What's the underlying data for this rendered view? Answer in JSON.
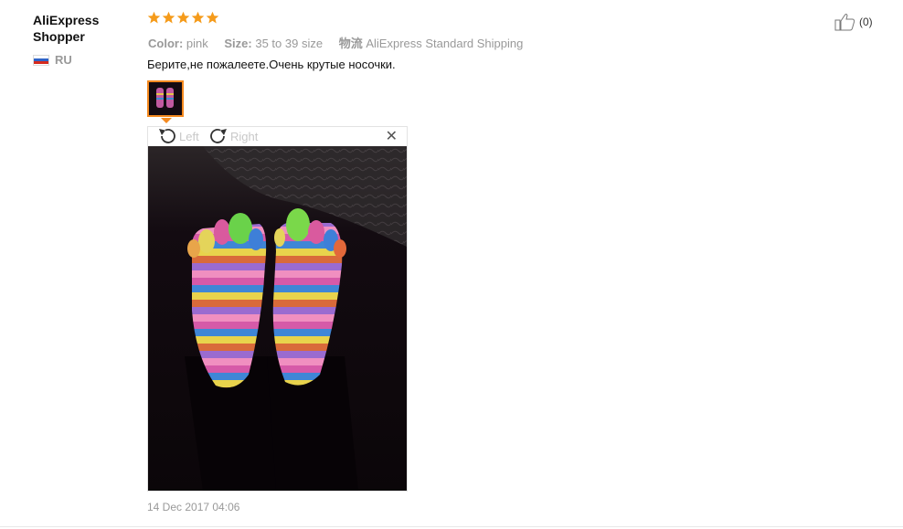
{
  "reviewer": {
    "name": "AliExpress Shopper",
    "country": "RU",
    "flag_colors": [
      "#ffffff",
      "#2f64c8",
      "#d52b1e"
    ]
  },
  "rating": {
    "stars": 5,
    "color": "#f59b1b"
  },
  "attributes": [
    {
      "key": "Color:",
      "value": "pink"
    },
    {
      "key": "Size:",
      "value": "35 to 39 size"
    },
    {
      "key": "物流",
      "value": "AliExpress Standard Shipping"
    }
  ],
  "review_text": "Берите,не пожалеете.Очень крутые носочки.",
  "viewer": {
    "rotate_left_label": "Left",
    "rotate_right_label": "Right",
    "close_icon": "close-icon",
    "accent": "#f58a1f"
  },
  "helpful": {
    "count_label": "(0)",
    "icon": "thumbs-up-icon"
  },
  "date": "14 Dec 2017 04:06"
}
